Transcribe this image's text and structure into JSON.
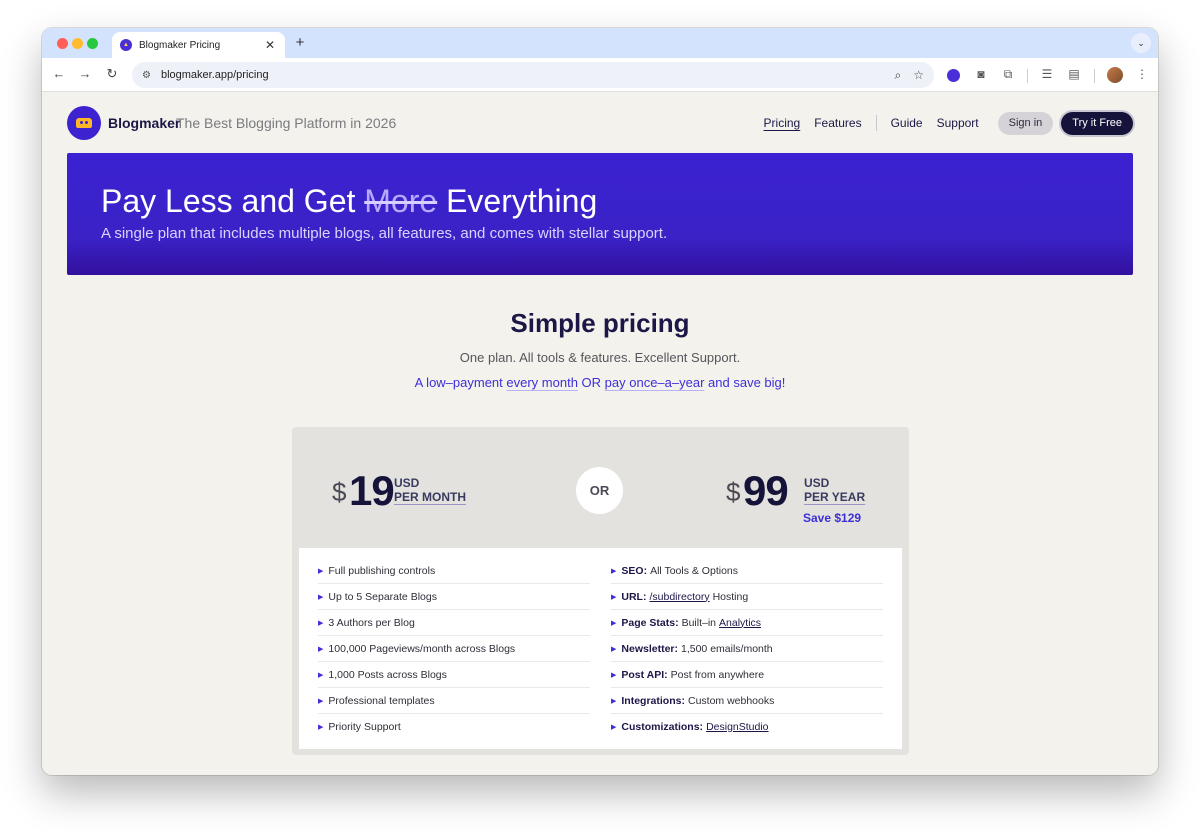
{
  "browser": {
    "tab_title": "Blogmaker Pricing",
    "url": "blogmaker.app/pricing"
  },
  "header": {
    "brand": "Blogmaker",
    "tagline": "The Best Blogging Platform in 2026",
    "nav": [
      "Pricing",
      "Features",
      "Guide",
      "Support"
    ],
    "signin_label": "Sign in",
    "try_label": "Try it Free"
  },
  "hero": {
    "title_before": "Pay Less and Get ",
    "title_strike": "More",
    "title_after": " Everything",
    "subtitle": "A single plan that includes multiple blogs, all features, and comes with stellar support."
  },
  "pricing": {
    "title": "Simple pricing",
    "subtitle": "One plan. All tools & features. Excellent Support.",
    "line_a": "A low–payment ",
    "line_b": "every month",
    "line_c": " OR ",
    "line_d": "pay once–a–year",
    "line_e": " and save big!",
    "monthly": {
      "currency": "$",
      "amount": "19",
      "unit": "USD",
      "period": "PER MONTH"
    },
    "or_label": "OR",
    "yearly": {
      "currency": "$",
      "amount": "99",
      "unit": "USD",
      "period": "PER YEAR",
      "save": "Save $129"
    }
  },
  "features_left": [
    "Full publishing controls",
    "Up to 5 Separate Blogs",
    "3 Authors per Blog",
    "100,000 Pageviews/month across Blogs",
    "1,000 Posts across Blogs",
    "Professional templates",
    "Priority Support"
  ],
  "features_right": [
    {
      "key": "SEO:",
      "pre": "All Tools & Options",
      "link": "",
      "post": ""
    },
    {
      "key": "URL:",
      "pre": "",
      "link": "/subdirectory",
      "post": "Hosting"
    },
    {
      "key": "Page Stats:",
      "pre": "Built–in",
      "link": "Analytics",
      "post": ""
    },
    {
      "key": "Newsletter:",
      "pre": "1,500 emails/month",
      "link": "",
      "post": ""
    },
    {
      "key": "Post API:",
      "pre": "Post from anywhere",
      "link": "",
      "post": ""
    },
    {
      "key": "Integrations:",
      "pre": "Custom webhooks",
      "link": "",
      "post": ""
    },
    {
      "key": "Customizations:",
      "pre": "",
      "link": "DesignStudio",
      "post": ""
    }
  ]
}
